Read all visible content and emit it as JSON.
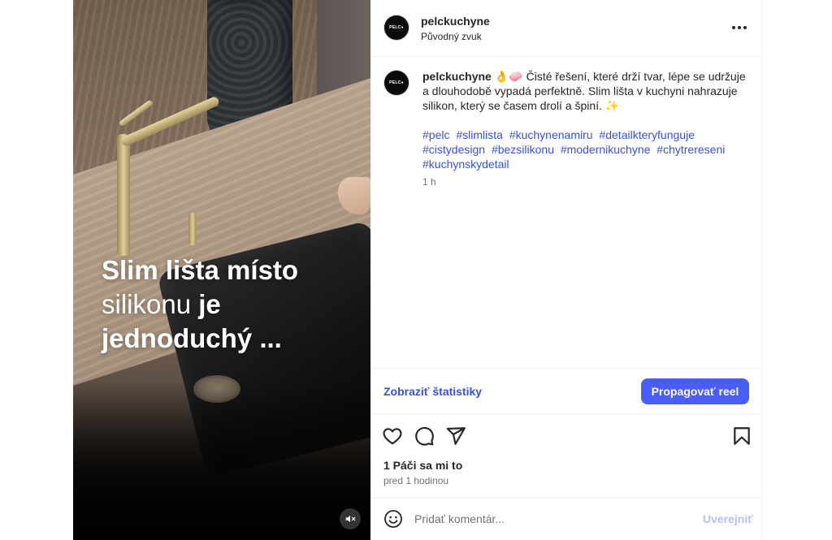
{
  "video": {
    "overlay_line1": "Slim lišta místo",
    "overlay_line2_light": "silikonu",
    "overlay_line2_bold": "je",
    "overlay_line3": "jednoduchý ..."
  },
  "header": {
    "avatar_text": "PELC●",
    "username": "pelckuchyne",
    "audio": "Původný zvuk"
  },
  "caption": {
    "avatar_text": "PELC●",
    "username": "pelckuchyne",
    "emojis": "👌🧼",
    "text": "Čisté řešení, které drží tvar, lépe se udržuje a dlouhodobě vypadá perfektně. Slim lišta v kuchyni nahrazuje silikon, který se časem drolí a špiní.",
    "sparkle": "✨",
    "hashtags": [
      "#pelc",
      "#slimlista",
      "#kuchynenamiru",
      "#detailkteryfunguje",
      "#cistydesign",
      "#bezsilikonu",
      "#modernikuchyne",
      "#chytrereseni",
      "#kuchynskydetail"
    ],
    "time": "1 h"
  },
  "stats": {
    "link": "Zobraziť štatistiky",
    "promote": "Propagovať reel"
  },
  "likes": {
    "text": "1 Páči sa mi to",
    "date": "pred 1 hodinou"
  },
  "comment": {
    "placeholder": "Pridať komentár...",
    "post": "Uverejniť"
  },
  "colors": {
    "link_blue": "#3951d6",
    "button_blue": "#4a5df9",
    "post_disabled": "#b3c0f7"
  }
}
